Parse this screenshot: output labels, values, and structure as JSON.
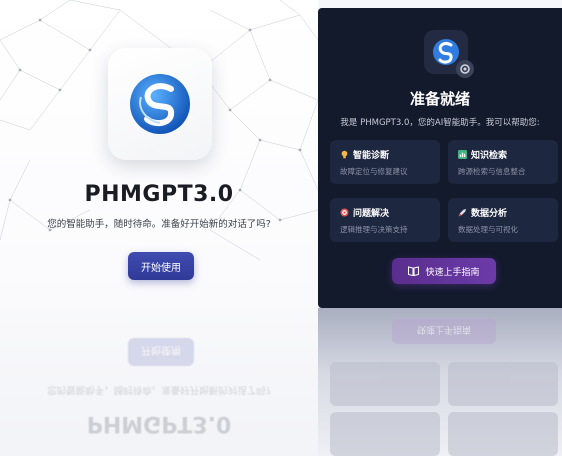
{
  "left": {
    "title": "PHMGPT3.0",
    "subtitle": "您的智能助手，随时待命。准备好开始新的对话了吗?",
    "start_button": "开始使用"
  },
  "right": {
    "title": "准备就绪",
    "intro": "我是 PHMGPT3.0，您的AI智能助手。我可以帮助您:",
    "features": [
      {
        "icon": "lightbulb-icon",
        "title": "智能诊断",
        "desc": "故障定位与修复建议",
        "color": "#f2b84b"
      },
      {
        "icon": "chart-icon",
        "title": "知识检索",
        "desc": "跨源检索与信息整合",
        "color": "#3fb37f"
      },
      {
        "icon": "target-icon",
        "title": "问题解决",
        "desc": "逻辑推理与决策支持",
        "color": "#e0554f"
      },
      {
        "icon": "rocket-icon",
        "title": "数据分析",
        "desc": "数据处理与可视化",
        "color": "#d9dce6"
      }
    ],
    "guide_button": "快速上手指南"
  },
  "colors": {
    "accent_blue": "#2f3a97",
    "dark_panel": "#131a2c",
    "feature_card": "#1e2740",
    "guide_purple": "#6b3aa8"
  }
}
